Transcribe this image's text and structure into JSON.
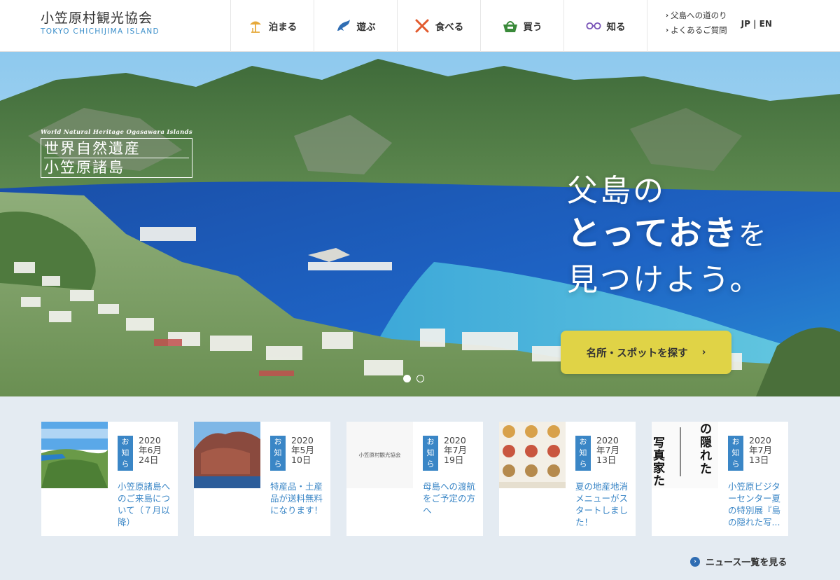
{
  "header": {
    "logo_jp": "小笠原村観光協会",
    "logo_en": "TOKYO CHICHIJIMA ISLAND",
    "nav": [
      {
        "label": "泊まる",
        "icon": "parasol-icon",
        "color": "#e6a93a"
      },
      {
        "label": "遊ぶ",
        "icon": "dolphin-icon",
        "color": "#2f6db3"
      },
      {
        "label": "食べる",
        "icon": "fork-knife-icon",
        "color": "#e25a2d"
      },
      {
        "label": "買う",
        "icon": "basket-icon",
        "color": "#3a8a3a"
      },
      {
        "label": "知る",
        "icon": "glasses-icon",
        "color": "#7a55b8"
      }
    ],
    "util_links": [
      "父島への道のり",
      "よくあるご質問"
    ],
    "lang": "JP | EN"
  },
  "hero": {
    "badge_en": "World Natural Heritage Ogasawara Islands",
    "badge_jp_line1": "世界自然遺産",
    "badge_jp_line2": "小笠原諸島",
    "copy_line1": "父島の",
    "copy_line2a": "とっておき",
    "copy_line2b": "を",
    "copy_line3": "見つけよう。",
    "cta_label": "名所・スポットを探す",
    "cta_arrow": "›",
    "slides": 2,
    "active_slide": 1
  },
  "news": {
    "badge_label": "お知らせ",
    "items": [
      {
        "date": "2020年6月24日",
        "title": "小笠原諸島へのご来島について（７月以降）",
        "thumb": "coast"
      },
      {
        "date": "2020年5月10日",
        "title": "特産品・土産品が送料無料になります！",
        "thumb": "cliff"
      },
      {
        "date": "2020年7月19日",
        "title": "母島への渡航をご予定の方へ",
        "thumb": "logo",
        "thumb_text": "小笠原村観光協会"
      },
      {
        "date": "2020年7月13日",
        "title": "夏の地産地消メニューがスタートしました！",
        "thumb": "menu"
      },
      {
        "date": "2020年7月13日",
        "title": "小笠原ビジターセンター夏の特別展『島の隠れた写...",
        "thumb": "poster",
        "thumb_text_a": "の隠れた",
        "thumb_text_b": "写真家た"
      }
    ],
    "more_label": "ニュース一覧を見る"
  }
}
